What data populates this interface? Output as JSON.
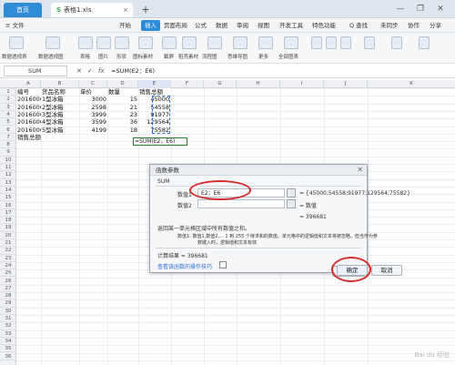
{
  "titlebar": {
    "home_tab": "首页",
    "file_tab": "表格1.xls",
    "new_tab": "+",
    "win_btns": [
      "—",
      "❐",
      "✕"
    ]
  },
  "menubar": {
    "file_menu": "≡ 文件",
    "items": [
      "开始",
      "插入",
      "页面布局",
      "公式",
      "数据",
      "审阅",
      "视图",
      "开发工具",
      "特色功能"
    ],
    "search": "Q 查找",
    "account": "未同步",
    "collab": "协作",
    "share": "分享"
  },
  "toolbar": {
    "labels": [
      "数据透视表",
      "数据透视图",
      "表格",
      "图片",
      "形状",
      "图标素材",
      "截屏",
      "稻壳素材",
      "流程图",
      "思维导图",
      "更多",
      "全部图表"
    ]
  },
  "formula_bar": {
    "name_box": "SUM",
    "cancel": "✕",
    "confirm": "✓",
    "fx": "fx",
    "formula": "=SUM(E2：E6)"
  },
  "sheet": {
    "columns": [
      "A",
      "B",
      "C",
      "D",
      "E",
      "F",
      "G",
      "H",
      "I",
      "J",
      "K"
    ],
    "rows": [
      "1",
      "2",
      "3",
      "4",
      "5",
      "6",
      "7",
      "8",
      "9",
      "10",
      "11",
      "12",
      "13",
      "14",
      "15",
      "16",
      "17",
      "18",
      "19",
      "20",
      "21",
      "22",
      "23",
      "24",
      "25",
      "26",
      "27",
      "28",
      "29",
      "30",
      "31",
      "32",
      "33",
      "34",
      "35",
      "36"
    ],
    "header": [
      "编号",
      "货品名称",
      "单价",
      "数量",
      "销售总额"
    ],
    "data": [
      [
        "20160001",
        "1型冰箱",
        "3000",
        "15",
        "45000"
      ],
      [
        "20160002",
        "2型冰箱",
        "2598",
        "21",
        "54558"
      ],
      [
        "20160003",
        "3型冰箱",
        "3999",
        "23",
        "91977"
      ],
      [
        "20160004",
        "4型冰箱",
        "3599",
        "36",
        "129564"
      ],
      [
        "20160005",
        "5型冰箱",
        "4199",
        "18",
        "75582"
      ]
    ],
    "total_label": "销售总额",
    "formula_cell": "=SUM(E2，E6)"
  },
  "dialog": {
    "title": "函数参数",
    "func_name": "SUM",
    "arg1_label": "数值1",
    "arg1_value": "E2：E6",
    "arg1_result": "= {45000;54558;91977;129564;75582}",
    "arg2_label": "数值2",
    "arg2_result": "= 数值",
    "total_result": "= 396681",
    "description": "返回某一单元格区域中所有数值之和。",
    "arg_help_1": "数值1: 数值1,数值2,... 1 到 255 个待求和的数值。单元格中的逻辑值和文本将被忽略。但当作为参",
    "arg_help_2": "数键入时，逻辑值和文本有效",
    "calc_result": "计算结果 = 396681",
    "help_link": "查看该函数的操作技巧",
    "ok": "确定",
    "cancel": "取消"
  },
  "colors": {
    "accent": "#2f8cd6",
    "highlight_ellipse": "#d42d2d"
  },
  "watermark": "Bai du 经验"
}
